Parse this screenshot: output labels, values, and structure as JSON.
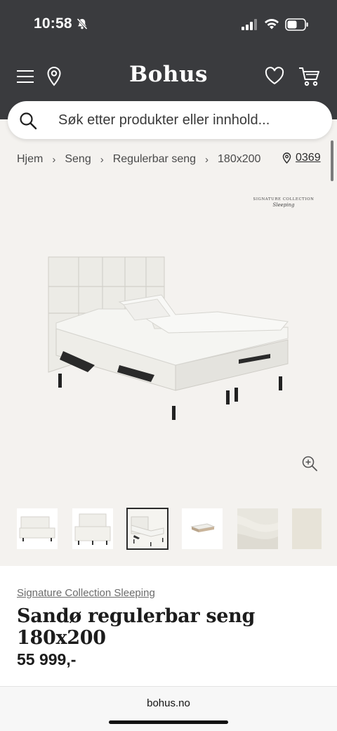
{
  "status_bar": {
    "time": "10:58",
    "icons": [
      "bell-muted-icon",
      "cellular-signal-icon",
      "wifi-icon",
      "battery-icon"
    ]
  },
  "header": {
    "logo": "Bohus",
    "icons": [
      "menu-icon",
      "location-pin-icon",
      "heart-icon",
      "cart-icon"
    ]
  },
  "search": {
    "placeholder": "Søk etter produkter eller innhold..."
  },
  "breadcrumb": {
    "items": [
      "Hjem",
      "Seng",
      "Regulerbar seng",
      "180x200"
    ],
    "store_number": "0369"
  },
  "gallery": {
    "brand_mark_line1": "SIGNATURE COLLECTION",
    "brand_mark_line2": "Sleeping",
    "thumbnail_count": 6,
    "active_thumbnail": 3
  },
  "product": {
    "brand": "Signature Collection Sleeping",
    "title": "Sandø regulerbar seng 180x200",
    "price": "55 999,-"
  },
  "browser": {
    "url": "bohus.no"
  },
  "colors": {
    "header_bg": "#3a3b3e",
    "page_bg": "#f4f2ef",
    "text_dark": "#1c1c1c"
  }
}
